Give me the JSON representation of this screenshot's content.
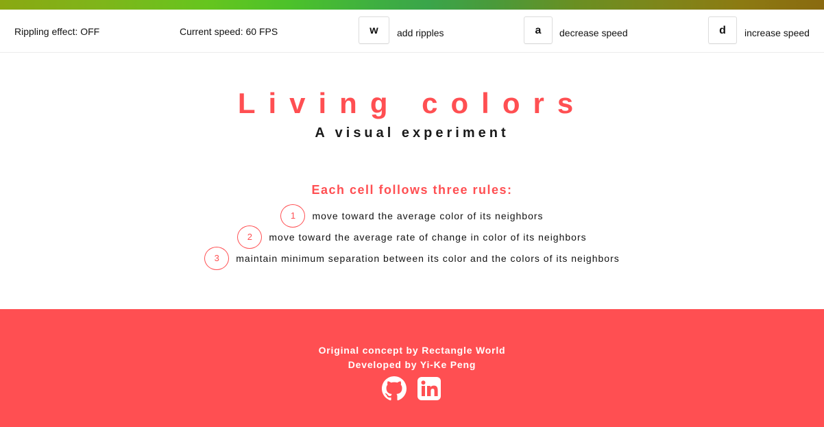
{
  "toolbar": {
    "rippling_status": "Rippling effect: OFF",
    "speed_status": "Current speed: 60 FPS",
    "keys": [
      {
        "key": "w",
        "label": "add ripples"
      },
      {
        "key": "a",
        "label": "decrease speed"
      },
      {
        "key": "d",
        "label": "increase speed"
      }
    ]
  },
  "hero": {
    "title": "Living colors",
    "subtitle": "A visual experiment"
  },
  "rules": {
    "heading": "Each cell follows three rules:",
    "items": [
      {
        "number": "1",
        "text": "move toward the average color of its neighbors"
      },
      {
        "number": "2",
        "text": "move toward the average rate of change in color of its neighbors"
      },
      {
        "number": "3",
        "text": "maintain minimum separation between its color and the colors of its neighbors"
      }
    ]
  },
  "footer": {
    "credit_line_1": "Original concept by Rectangle World",
    "credit_line_2": "Developed by Yi-Ke Peng",
    "social_icons": [
      "github-icon",
      "linkedin-icon"
    ]
  },
  "colors": {
    "accent": "#ff4f52",
    "text": "#111111",
    "footer_text": "#ffffff"
  }
}
